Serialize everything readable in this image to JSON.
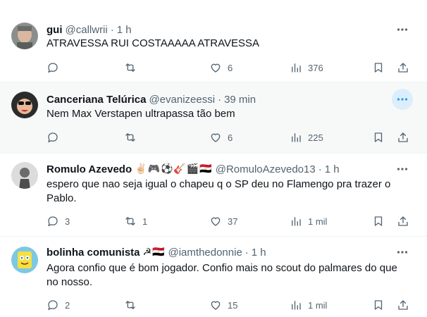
{
  "tweets": [
    {
      "name": "gui",
      "emojis": "",
      "handle": "@callwrii",
      "separator": "·",
      "time": "1 h",
      "lines": [
        "ATRAVESSA RUI COSTAAAAA ATRAVESSA"
      ],
      "replies": "",
      "retweets": "",
      "likes": "6",
      "views": "376"
    },
    {
      "name": "Canceriana Telúrica",
      "emojis": "",
      "handle": "@evanizeessi",
      "separator": "·",
      "time": "39 min",
      "lines": [
        "Nem Max Verstapen ultrapassa tão bem"
      ],
      "replies": "",
      "retweets": "",
      "likes": "6",
      "views": "225"
    },
    {
      "name": "Romulo Azevedo",
      "emojis": "✌🏻🎮⚽🎸🎬🇪🇬",
      "handle": "@RomuloAzevedo13",
      "separator": "·",
      "time": "1 h",
      "lines": [
        "espero que nao seja igual o chapeu q o SP deu no Flamengo pra trazer o",
        "Pablo."
      ],
      "replies": "3",
      "retweets": "1",
      "likes": "37",
      "views": "1 mil"
    },
    {
      "name": "bolinha comunista",
      "emojis": "☭🇪🇬",
      "handle": "@iamthedonnie",
      "separator": "·",
      "time": "1 h",
      "lines": [
        "Agora confio que é bom jogador. Confio mais no scout do palmares do que",
        "no nosso."
      ],
      "replies": "2",
      "retweets": "",
      "likes": "15",
      "views": "1 mil"
    }
  ],
  "icons": {
    "reply": "reply-icon",
    "retweet": "retweet-icon",
    "like": "heart-icon",
    "views": "views-icon",
    "bookmark": "bookmark-icon",
    "share": "share-icon",
    "more": "more-icon"
  },
  "colors": {
    "text": "#0f1419",
    "secondary": "#536471",
    "hover_bg": "#f7f9f9",
    "accent": "#1d9bf0",
    "divider": "#eff3f4"
  }
}
